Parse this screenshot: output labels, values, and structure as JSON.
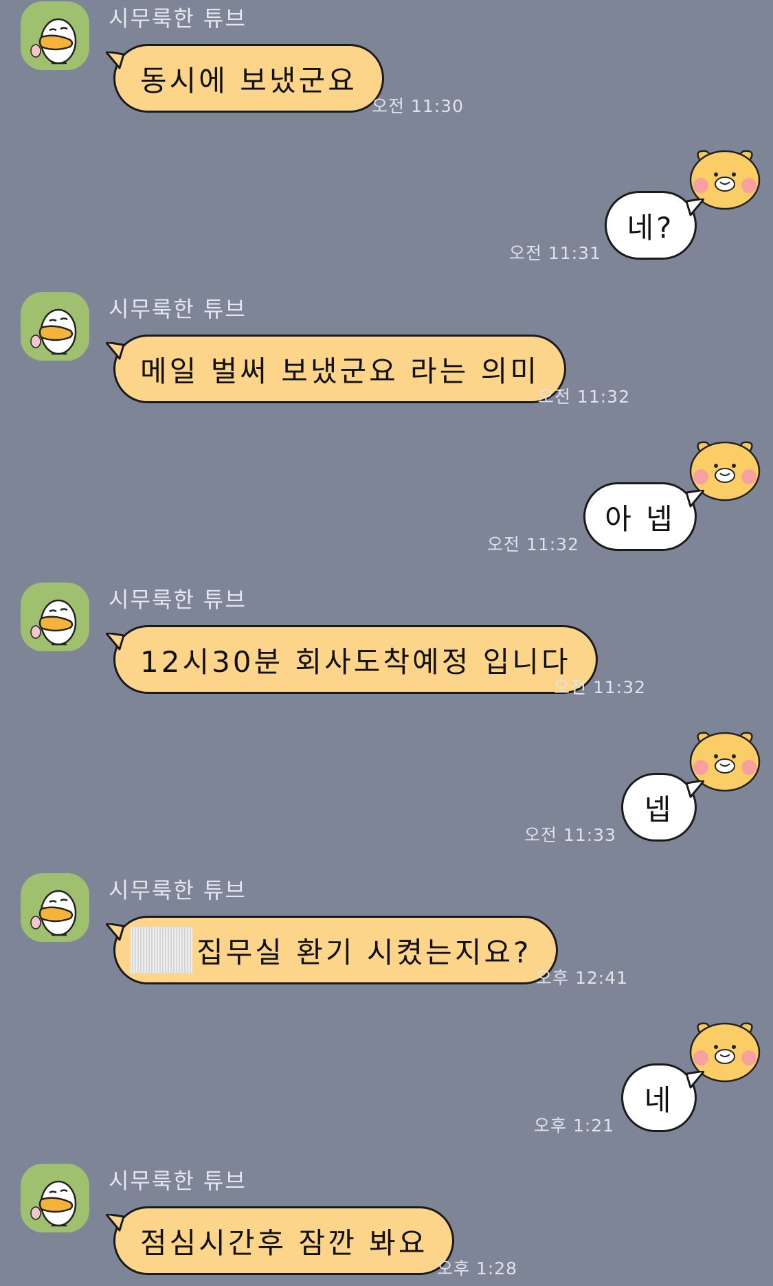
{
  "conversation": {
    "partner_name": "시무룩한 튜브",
    "messages": [
      {
        "direction": "in",
        "text": "동시에 보냈군요",
        "time": "오전 11:30"
      },
      {
        "direction": "out",
        "text": "네?",
        "time": "오전 11:31"
      },
      {
        "direction": "in",
        "text": "메일 벌써 보냈군요 라는 의미",
        "time": "오전 11:32"
      },
      {
        "direction": "out",
        "text": "아 넵",
        "time": "오전 11:32"
      },
      {
        "direction": "in",
        "text": "12시30분 회사도착예정 입니다",
        "time": "오전 11:32"
      },
      {
        "direction": "out",
        "text": "넵",
        "time": "오전 11:33"
      },
      {
        "direction": "in",
        "text": "집무실 환기 시켰는지요?",
        "time": "오후 12:41"
      },
      {
        "direction": "out",
        "text": "네",
        "time": "오후 1:21"
      },
      {
        "direction": "in",
        "text": "점심시간후 잠깐 봐요",
        "time": "오후 1:28"
      }
    ]
  },
  "colors": {
    "background": "#7d8596",
    "incoming_bubble": "#fcd58b",
    "outgoing_bubble": "#ffffff",
    "incoming_avatar_bg": "#9ec06f"
  },
  "icons": {
    "incoming_avatar": "tube-duck-icon",
    "outgoing_avatar": "choonsik-cat-icon"
  }
}
